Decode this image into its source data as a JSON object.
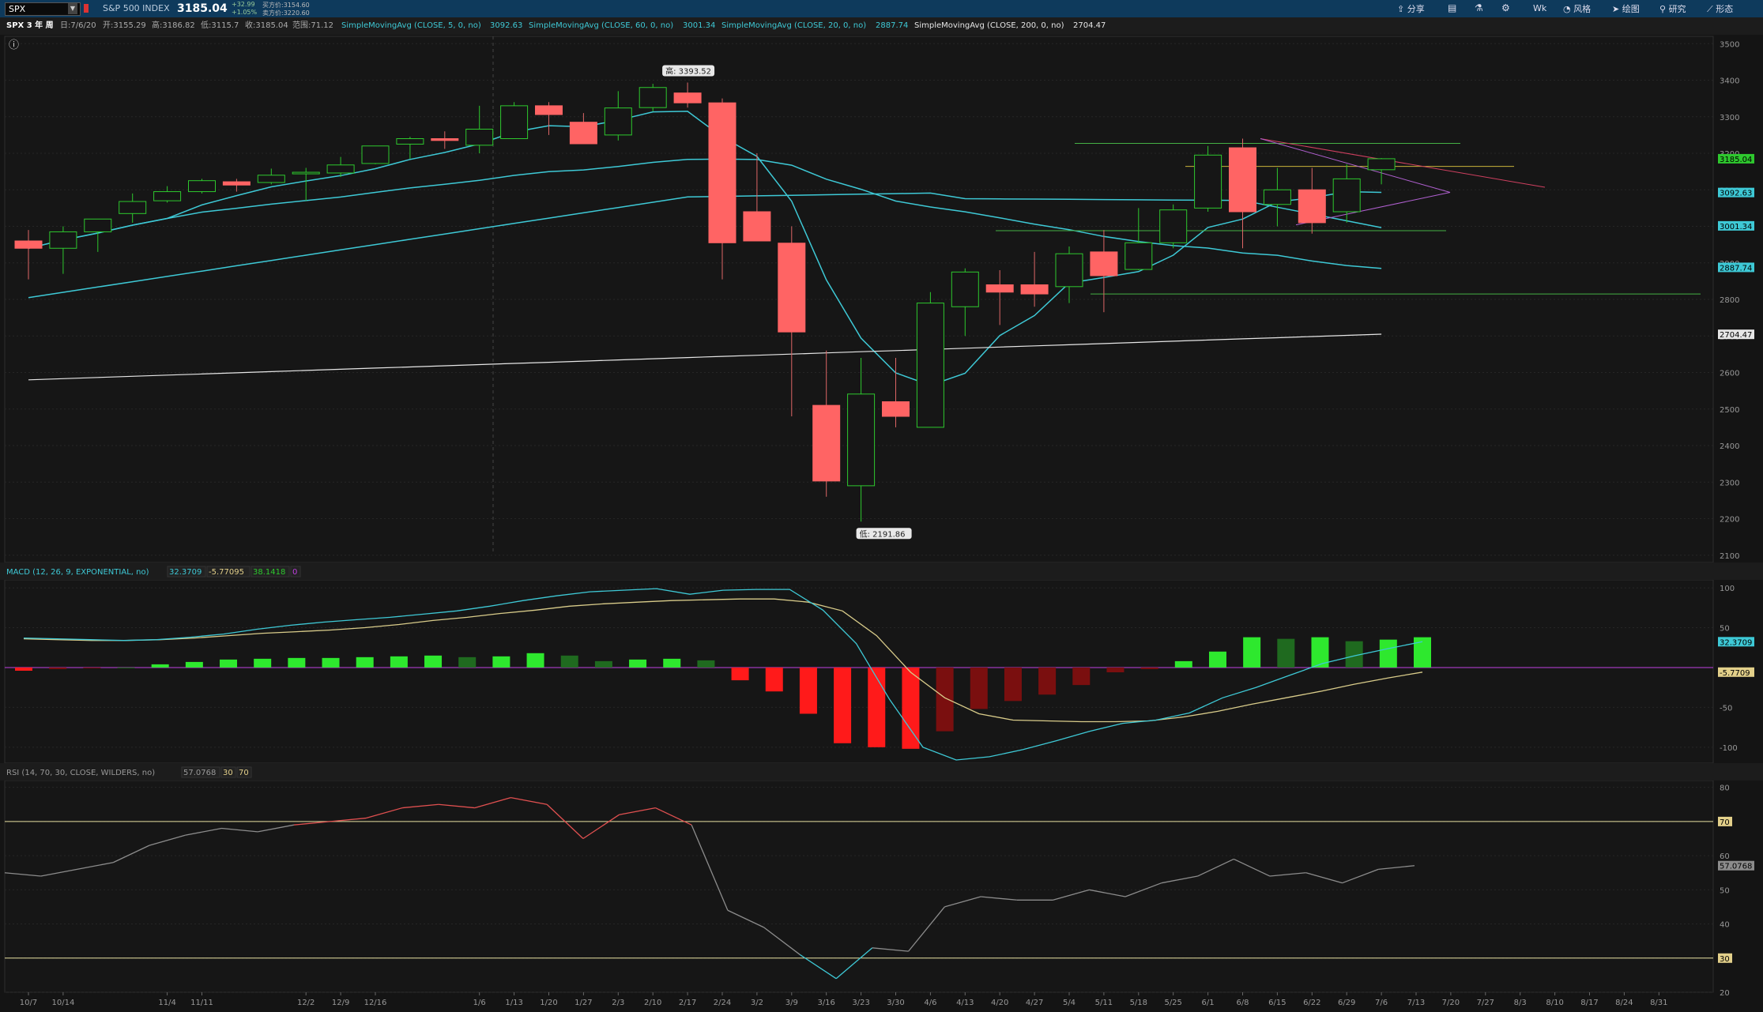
{
  "toolbar": {
    "symbol": "SPX",
    "description": "S&P 500 INDEX",
    "last_price": "3185.04",
    "change": "+32.99",
    "change_pct": "+1.05%",
    "bid": "买方价:3154.60",
    "ask": "卖方价:3220.60",
    "buttons": [
      "分享",
      "Wk",
      "风格",
      "绘图",
      "研究",
      "形态"
    ]
  },
  "studybar": {
    "period": "SPX 3 年 周",
    "date": "日:7/6/20",
    "open": "开:3155.29",
    "high": "高:3186.82",
    "low": "低:3115.7",
    "close": "收:3185.04",
    "range": "范围:71.12",
    "ma5_label": "SimpleMovingAvg (CLOSE, 5, 0, no)",
    "ma5_value": "3092.63",
    "ma60_label": "SimpleMovingAvg (CLOSE, 60, 0, no)",
    "ma60_value": "3001.34",
    "ma20_label": "SimpleMovingAvg (CLOSE, 20, 0, no)",
    "ma20_value": "2887.74",
    "ma200_label": "SimpleMovingAvg (CLOSE, 200, 0, no)",
    "ma200_value": "2704.47"
  },
  "colors": {
    "up": "#2ec82e",
    "down": "#ff6464",
    "ma_cyan": "#3ec9d6",
    "ma_white": "#e6e6e6",
    "macd_signal": "#d9cc8a",
    "rsi_line": "#8c8c8c",
    "rsi_over": "#e05050",
    "level_line": "#e8e0a0",
    "zero_line": "#c040e0"
  },
  "chart_data": [
    {
      "type": "candlestick",
      "name": "SPX weekly",
      "x": [
        "10/7",
        "10/14",
        "10/21",
        "10/28",
        "11/4",
        "11/11",
        "11/18",
        "11/25",
        "12/2",
        "12/9",
        "12/16",
        "12/23",
        "12/30",
        "1/6",
        "1/13",
        "1/20",
        "1/27",
        "2/3",
        "2/10",
        "2/17",
        "2/24",
        "3/2",
        "3/9",
        "3/16",
        "3/23",
        "3/30",
        "4/6",
        "4/13",
        "4/20",
        "4/27",
        "5/4",
        "5/11",
        "5/18",
        "5/25",
        "6/1",
        "6/8",
        "6/15",
        "6/22",
        "6/29",
        "7/6"
      ],
      "open": [
        2960,
        2940,
        2985,
        3035,
        3070,
        3095,
        3122,
        3120,
        3145,
        3146,
        3172,
        3225,
        3240,
        3222,
        3240,
        3330,
        3285,
        3250,
        3325,
        3365,
        3338,
        3040,
        2954,
        2510,
        2290,
        2520,
        2450,
        2780,
        2840,
        2840,
        2835,
        2930,
        2882,
        2955,
        3050,
        3215,
        3060,
        3100,
        3040,
        3155
      ],
      "high": [
        2990,
        3000,
        3010,
        3090,
        3110,
        3130,
        3130,
        3158,
        3160,
        3190,
        3215,
        3245,
        3260,
        3330,
        3340,
        3340,
        3310,
        3370,
        3390,
        3393.52,
        3350,
        3200,
        3000,
        2660,
        2640,
        2640,
        2820,
        2885,
        2880,
        2930,
        2945,
        2990,
        3050,
        3060,
        3220,
        3240,
        3160,
        3160,
        3170,
        3186.82
      ],
      "low": [
        2855,
        2870,
        2930,
        3010,
        3065,
        3090,
        3095,
        3115,
        3070,
        3135,
        3170,
        3185,
        3212,
        3200,
        3260,
        3250,
        3245,
        3235,
        3315,
        3325,
        2855,
        2975,
        2480,
        2260,
        2191.86,
        2450,
        2450,
        2700,
        2730,
        2780,
        2790,
        2765,
        2880,
        2940,
        3040,
        2940,
        3000,
        2980,
        3010,
        3115
      ],
      "close": [
        2940,
        2985,
        3020,
        3068,
        3095,
        3125,
        3113,
        3140,
        3148,
        3168,
        3220,
        3240,
        3235,
        3266,
        3330,
        3306,
        3226,
        3324,
        3380,
        3338,
        2955,
        2960,
        2711,
        2303,
        2541,
        2480,
        2790,
        2875,
        2820,
        2815,
        2925,
        2865,
        2955,
        3045,
        3195,
        3040,
        3100,
        3010,
        3130,
        3185.04
      ]
    },
    {
      "type": "line",
      "name": "MACD (12, 26, 9, EXPONENTIAL, no)",
      "values": {
        "value": 32.3709,
        "avg": -5.77095,
        "diff": 38.1418,
        "zero": 0
      },
      "ylim": [
        -120,
        110
      ],
      "y_ticks": [
        100,
        50,
        -50,
        -100
      ],
      "hist": [
        -4,
        -2,
        -1,
        0,
        4,
        7,
        10,
        11,
        12,
        12,
        13,
        14,
        15,
        13,
        14,
        18,
        15,
        8,
        10,
        11,
        9,
        -16,
        -30,
        -58,
        -95,
        -100,
        -102,
        -80,
        -52,
        -42,
        -34,
        -22,
        -6,
        -2,
        8,
        20,
        38,
        36,
        38,
        33,
        35,
        38
      ],
      "macd": [
        37,
        36,
        35,
        34,
        35,
        38,
        42,
        48,
        53,
        57,
        60,
        63,
        67,
        71,
        77,
        84,
        90,
        95,
        97,
        99,
        92,
        97,
        98,
        98,
        72,
        30,
        -40,
        -100,
        -116,
        -112,
        -103,
        -92,
        -80,
        -70,
        -66,
        -57,
        -38,
        -25,
        -10,
        5,
        15,
        24,
        32.37
      ],
      "signal": [
        36,
        35,
        34,
        34,
        35,
        37,
        40,
        43,
        45,
        47,
        50,
        54,
        59,
        63,
        68,
        72,
        77,
        80,
        82,
        84,
        85,
        86,
        86,
        82,
        71,
        40,
        -6,
        -38,
        -58,
        -66,
        -67,
        -68,
        -68,
        -67,
        -62,
        -55,
        -46,
        -38,
        -30,
        -21,
        -13,
        -5.77
      ]
    },
    {
      "type": "line",
      "name": "RSI (14, 70, 30, CLOSE, WILDERS, no)",
      "value": 57.0768,
      "levels": [
        30,
        70
      ],
      "ylim": [
        20,
        82
      ],
      "y_ticks": [
        80,
        70,
        60,
        50,
        40,
        30,
        20
      ],
      "values": [
        55,
        54,
        56,
        58,
        63,
        66,
        68,
        67,
        69,
        70,
        71,
        74,
        75,
        74,
        77,
        75,
        65,
        72,
        74,
        69,
        44,
        39,
        31,
        24,
        33,
        32,
        45,
        48,
        47,
        47,
        50,
        48,
        52,
        54,
        59,
        54,
        55,
        52,
        56,
        57.08
      ]
    }
  ],
  "price_axis": {
    "ylim": [
      2080,
      3520
    ],
    "ticks": [
      3500,
      3400,
      3300,
      3200,
      3100,
      3000,
      2900,
      2800,
      2700,
      2600,
      2500,
      2400,
      2300,
      2200,
      2100
    ],
    "badges": {
      "close": "3185.04",
      "ma5": "3092.63",
      "ma60": "3001.34",
      "ma20": "2887.74",
      "ma200": "2704.47"
    },
    "high_marker": "高: 3393.52",
    "low_marker": "低: 2191.86"
  },
  "x_axis": {
    "labels": [
      "10/7",
      "10/14",
      "11/4",
      "11/11",
      "12/2",
      "12/9",
      "12/16",
      "1/6",
      "1/13",
      "1/20",
      "1/27",
      "2/3",
      "2/10",
      "2/17",
      "2/24",
      "3/2",
      "3/9",
      "3/16",
      "3/23",
      "3/30",
      "4/6",
      "4/13",
      "4/20",
      "4/27",
      "5/4",
      "5/11",
      "5/18",
      "5/25",
      "6/1",
      "6/8",
      "6/15",
      "6/22",
      "6/29",
      "7/6",
      "7/13",
      "7/20",
      "7/27",
      "8/3",
      "8/10",
      "8/17",
      "8/24",
      "8/31"
    ]
  },
  "panel_labels": {
    "macd_title": "MACD (12, 26, 9, EXPONENTIAL, no)",
    "macd_value": "32.3709",
    "macd_avg": "-5.77095",
    "macd_diff": "38.1418",
    "macd_zero": "0",
    "rsi_title": "RSI (14, 70, 30, CLOSE, WILDERS, no)",
    "rsi_value": "57.0768",
    "rsi_ob": "70",
    "rsi_os": "30",
    "macd_badge": "32.3709",
    "macd_avg_badge": "-5.7709",
    "rsi_badge": "57.0768"
  }
}
